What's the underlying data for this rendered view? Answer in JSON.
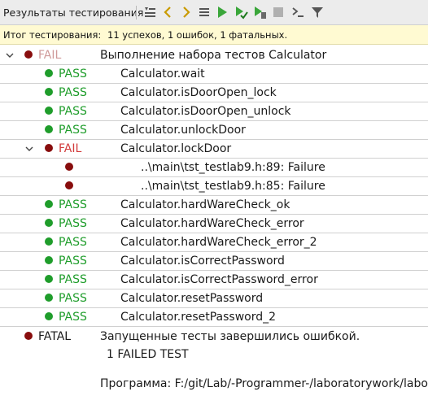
{
  "toolbar": {
    "title": "Результаты тестирования",
    "icons": [
      "filter-sort-icon",
      "prev-arrow-icon",
      "next-arrow-icon",
      "list-icon",
      "run-all-icon",
      "run-selected-icon",
      "run-file-icon",
      "stop-icon",
      "output-icon",
      "filter-icon"
    ]
  },
  "summary": {
    "label": "Итог тестирования:",
    "text": "11 успехов, 1 ошибок, 1 фатальных."
  },
  "root": {
    "status": "FAIL",
    "desc": "Выполнение набора тестов Calculator"
  },
  "tests": [
    {
      "status": "PASS",
      "desc": "Calculator.wait"
    },
    {
      "status": "PASS",
      "desc": "Calculator.isDoorOpen_lock"
    },
    {
      "status": "PASS",
      "desc": "Calculator.isDoorOpen_unlock"
    },
    {
      "status": "PASS",
      "desc": "Calculator.unlockDoor"
    },
    {
      "status": "FAIL",
      "desc": "Calculator.lockDoor"
    },
    {
      "status": "",
      "desc": "..\\main\\tst_testlab9.h:89: Failure"
    },
    {
      "status": "",
      "desc": "..\\main\\tst_testlab9.h:85: Failure"
    },
    {
      "status": "PASS",
      "desc": "Calculator.hardWareCheck_ok"
    },
    {
      "status": "PASS",
      "desc": "Calculator.hardWareCheck_error"
    },
    {
      "status": "PASS",
      "desc": "Calculator.hardWareCheck_error_2"
    },
    {
      "status": "PASS",
      "desc": "Calculator.isCorrectPassword"
    },
    {
      "status": "PASS",
      "desc": "Calculator.isCorrectPassword_error"
    },
    {
      "status": "PASS",
      "desc": "Calculator.resetPassword"
    },
    {
      "status": "PASS",
      "desc": "Calculator.resetPassword_2"
    }
  ],
  "fatal": {
    "status": "FATAL",
    "line1": "Запущенные тесты завершились ошибкой.",
    "line2": "1 FAILED TEST",
    "line3": "Программа: F:/git/Lab/-Programmer-/laboratorywork/labor"
  },
  "colors": {
    "pass": "#1f9d2b",
    "fail": "#d23b3b",
    "bullet_fail": "#880d0d",
    "summary_bg": "#fffad2"
  }
}
